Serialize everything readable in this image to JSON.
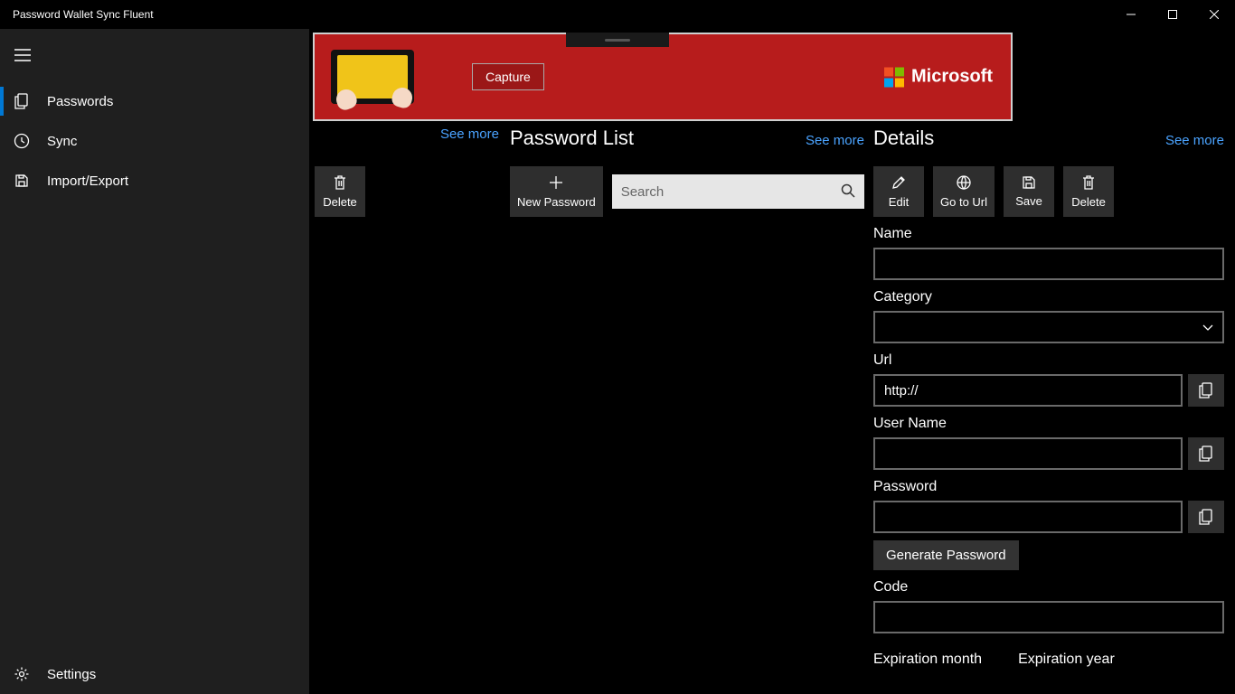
{
  "window": {
    "title": "Password Wallet Sync Fluent"
  },
  "sidebar": {
    "items": [
      {
        "label": "Passwords"
      },
      {
        "label": "Sync"
      },
      {
        "label": "Import/Export"
      }
    ],
    "settings": "Settings"
  },
  "banner": {
    "capture": "Capture",
    "brand": "Microsoft"
  },
  "links": {
    "see_more": "See more"
  },
  "col1": {
    "delete": "Delete"
  },
  "col2": {
    "title": "Password List",
    "new_password": "New Password",
    "search_placeholder": "Search"
  },
  "col3": {
    "title": "Details",
    "edit": "Edit",
    "goto": "Go to Url",
    "save": "Save",
    "delete": "Delete",
    "labels": {
      "name": "Name",
      "category": "Category",
      "url": "Url",
      "username": "User Name",
      "password": "Password",
      "code": "Code",
      "exp_month": "Expiration month",
      "exp_year": "Expiration year"
    },
    "values": {
      "url": "http://"
    },
    "generate": "Generate Password"
  }
}
